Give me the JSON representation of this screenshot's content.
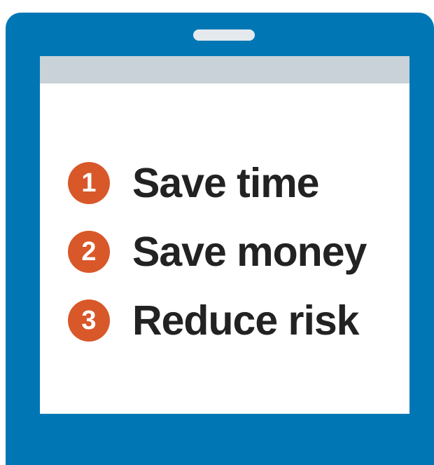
{
  "colors": {
    "frame": "#0077b4",
    "speaker": "#e4e9ee",
    "status_bar": "#c8d2d8",
    "badge": "#d8582a",
    "text": "#222222"
  },
  "icons": {
    "device": "tablet-frame",
    "speaker": "speaker-slot"
  },
  "list": {
    "items": [
      {
        "number": "1",
        "label": "Save time"
      },
      {
        "number": "2",
        "label": "Save money"
      },
      {
        "number": "3",
        "label": "Reduce risk"
      }
    ]
  }
}
